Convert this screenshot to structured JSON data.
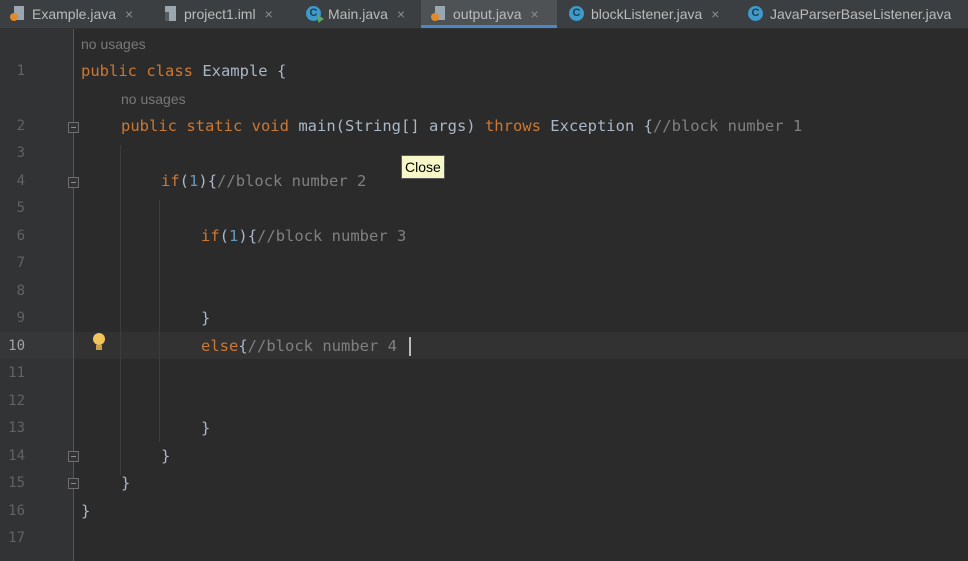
{
  "tabs": [
    {
      "label": "Example.java",
      "icon": "java-file-icon",
      "active": false
    },
    {
      "label": "project1.iml",
      "icon": "iml-file-icon",
      "active": false
    },
    {
      "label": "Main.java",
      "icon": "runnable-class-icon",
      "active": false
    },
    {
      "label": "output.java",
      "icon": "java-file-icon",
      "active": true
    },
    {
      "label": "blockListener.java",
      "icon": "class-icon",
      "active": false
    },
    {
      "label": "JavaParserBaseListener.java",
      "icon": "class-icon",
      "active": false
    }
  ],
  "tab_close_glyph": "×",
  "tooltip": "Close",
  "editor": {
    "usage_hint": "no usages",
    "current_line": 10,
    "line_numbers": [
      "1",
      "2",
      "3",
      "4",
      "5",
      "6",
      "7",
      "8",
      "9",
      "10",
      "11",
      "12",
      "13",
      "14",
      "15",
      "16",
      "17"
    ],
    "lines": {
      "l1": {
        "kw": "public class",
        "rest": " Example {"
      },
      "l2": {
        "kw1": "public static void",
        "fn": "main",
        "args": "(String[] args) ",
        "kw2": "throws",
        "rest": " Exception {",
        "comment": "//block number 1"
      },
      "l4": {
        "kw": "if",
        "open": "(",
        "num": "1",
        "close": "){",
        "comment": "//block number 2"
      },
      "l6": {
        "kw": "if",
        "open": "(",
        "num": "1",
        "close": "){",
        "comment": "//block number 3"
      },
      "l9": {
        "brace": "}"
      },
      "l10": {
        "kw": "else",
        "brace": "{",
        "comment": "//block number 4"
      },
      "l13": {
        "brace": "}"
      },
      "l14": {
        "brace": "}"
      },
      "l15": {
        "brace": "}"
      },
      "l16": {
        "brace": "}"
      }
    }
  },
  "colors": {
    "background": "#2b2b2b",
    "keyword": "#cc7832",
    "number": "#6897bb",
    "comment": "#808080",
    "identifier": "#a9b7c6",
    "accent": "#4a88c7"
  }
}
